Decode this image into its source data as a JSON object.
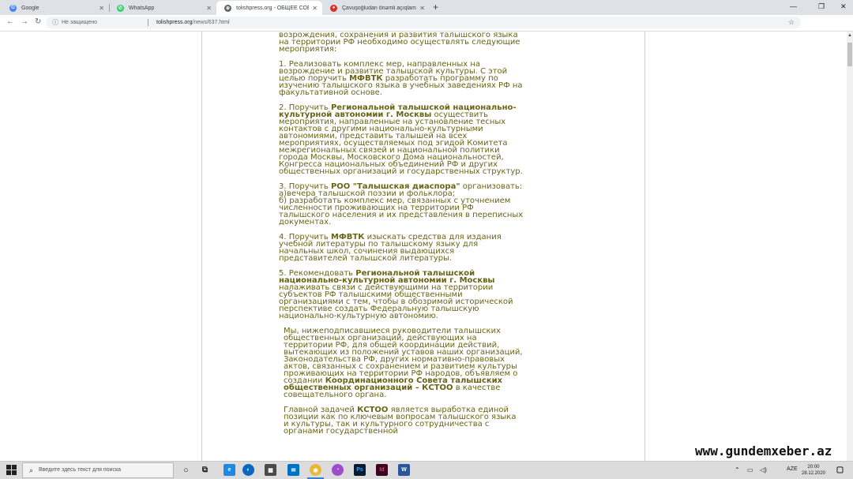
{
  "tabs": [
    {
      "title": "Google",
      "icon": "google-icon",
      "color": "#4285f4",
      "active": false
    },
    {
      "title": "WhatsApp",
      "icon": "whatsapp-icon",
      "color": "#25d366",
      "active": false
    },
    {
      "title": "tolishpress.org - ОБЩЕЕ СОБРАНИЕ",
      "icon": "site-icon",
      "color": "#5f6368",
      "active": true
    },
    {
      "title": "Çavuşoğludan önəmli açıqlama:",
      "icon": "news-icon",
      "color": "#d93025",
      "active": false
    }
  ],
  "address": {
    "security": "Не защищено",
    "domain": "tolishpress.org",
    "path": "/news/637.html"
  },
  "article": {
    "p0": "возрождения, сохранения и развития талышского языка на территории РФ необходимо осуществлять следующие мероприятия:",
    "p1a": "1. Реализовать комплекс мер, направленных на возрождение и развитие талышской культуры. С этой целью поручить ",
    "p1b": "МФВТК",
    "p1c": " разработать программу по изучению талышского языка в учебных заведениях РФ на факультативной основе.",
    "p2a": "2. Поручить ",
    "p2b": "Региональной талышской национально-культурной автономии г. Москвы",
    "p2c": " осуществить мероприятия, направленные на установление тесных контактов с другими национально-культурными автономиями, представить талышей на всех мероприятиях, осуществляемых под эгидой Комитета межрегиональных связей и национальной политики города Москвы, Московского Дома национальностей, Конгресса национальных объединений РФ и других общественных организаций и государственных структур.",
    "p3a": "3. Поручить ",
    "p3b": "РОО \"Талышская диаспора\"",
    "p3c": " организовать:",
    "p3d": "а)вечера талышской поэзии и фольклора;",
    "p3e": "б) разработать комплекс мер, связанных с уточнением численности проживающих на территории РФ талышского населения и их представления в переписных документах.",
    "p4a": "4. Поручить ",
    "p4b": "МФВТК",
    "p4c": " изыскать средства для издания учебной литературы по талышскому языку для начальных школ, сочинения выдающихся представителей талышской литературы.",
    "p5a": "5. Рекомендовать ",
    "p5b": "Региональной талышской национально-культурной автономии г. Москвы",
    "p5c": " налаживать связи с действующими на территории субъектов РФ талышскими общественными организациями с тем, чтобы в обозримой исторической перспективе создать Федеральную талышскую национально-культурную автономию.",
    "p6a": "Мы, нижеподписавшиеся руководители талышских общественных организаций, действующих на территории РФ, для общей координации действий, вытекающих из положений уставов наших организаций, Законодательства РФ, других нормативно-правовых актов, связанных с сохранением и развитием культуры проживающих на территории РФ народов, объявляем о создании ",
    "p6b": "Координационного Совета талышских общественных организаций – КСТОО",
    "p6c": " в качестве совещательного органа.",
    "p7a": "Главной задачей ",
    "p7b": "КСТОО",
    "p7c": " является выработка единой позиции как по ключевым вопросам талышского языка и культуры, так и культурного сотрудничества с органами государственной"
  },
  "taskbar": {
    "search_placeholder": "Введите здесь текст для поиска",
    "language": "AZE",
    "time": "20:00",
    "date": "28.12.2020"
  },
  "watermark": "www.gundemxeber.az",
  "colors": {
    "article_text": "#6a6414",
    "tabbar": "#dee1e6",
    "taskbar": "#dcdcdc"
  }
}
